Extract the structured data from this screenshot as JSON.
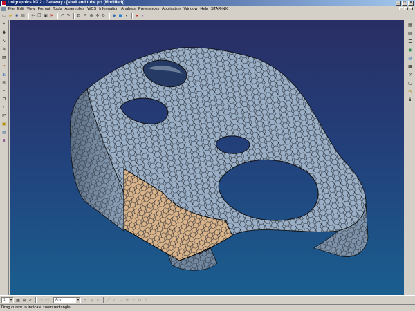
{
  "window": {
    "title": "Unigraphics NX 2 - Gateway - [shell and tube.prt (Modified)]"
  },
  "menus": [
    "File",
    "Edit",
    "View",
    "Format",
    "Tools",
    "Assemblies",
    "WCS",
    "Information",
    "Analysis",
    "Preferences",
    "Application",
    "Window",
    "Help",
    "STAR-NX"
  ],
  "toolbar": {
    "icons": [
      "new-icon",
      "open-icon",
      "save-icon",
      "print-icon",
      "cut-icon",
      "copy-icon",
      "paste-icon",
      "delete-icon",
      "undo-icon",
      "redo-icon",
      "fit-icon",
      "zoom-icon",
      "zoom-window-icon",
      "pan-icon",
      "rotate-icon",
      "render-style-icon",
      "shaded-icon",
      "layer-icon",
      "color-icon",
      "show-hide-icon"
    ]
  },
  "left_rail": {
    "icons": [
      "select-icon",
      "point-icon",
      "curve-icon",
      "sketch-icon",
      "extrude-icon",
      "revolve-icon",
      "sweep-icon",
      "hole-icon",
      "boss-icon",
      "pocket-icon",
      "blend-icon",
      "chamfer-icon",
      "shell-icon",
      "mesh-icon",
      "part-icon"
    ]
  },
  "right_rail": {
    "icons": [
      "assembly-navigator-icon",
      "part-navigator-icon",
      "roles-icon",
      "history-icon",
      "web-icon",
      "palette-icon",
      "help-icon",
      "system-icon",
      "clock-icon",
      "info-icon"
    ]
  },
  "bottom_toolbar": {
    "combo1_value": "1",
    "combo2_value": "Any",
    "icons": [
      "filter-icon",
      "select-all-icon",
      "deselect-icon",
      "snap-end-icon",
      "snap-mid-icon",
      "snap-center-icon",
      "snap-point-icon",
      "snap-quadrant-icon",
      "snap-intersect-icon",
      "snap-existing-icon",
      "snap-arc-icon",
      "snap-face-icon",
      "snap-plus-icon"
    ]
  },
  "status": {
    "text": "Drag cursor to indicate zoom rectangle"
  },
  "colors": {
    "mesh_fill": "#9bb0c7",
    "mesh_stroke": "#1b1f28",
    "highlight_fill": "#d9b48b",
    "background_top": "#292e64",
    "background_bottom": "#1a5e8f"
  }
}
